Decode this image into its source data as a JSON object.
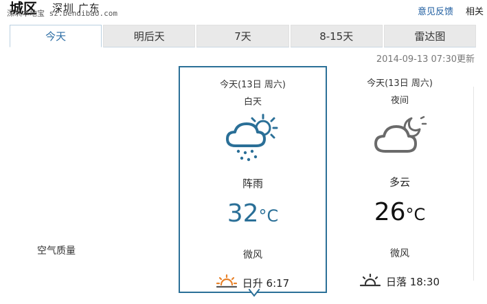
{
  "header": {
    "city": "城区",
    "region": "深圳 广东",
    "watermark": "深圳本地宝 sz.bendibao.com",
    "feedback": "意见反馈",
    "related": "相关"
  },
  "tabs": [
    {
      "label": "今天",
      "active": true
    },
    {
      "label": "明后天",
      "active": false
    },
    {
      "label": "7天",
      "active": false
    },
    {
      "label": "8-15天",
      "active": false
    },
    {
      "label": "雷达图",
      "active": false
    }
  ],
  "updated": "2014-09-13 07:30更新",
  "air_quality_label": "空气质量",
  "day": {
    "date": "今天(13日 周六)",
    "period": "白天",
    "icon": "thunder-shower-icon",
    "condition": "阵雨",
    "temp": "32",
    "unit": "°C",
    "wind": "微风",
    "sun_icon": "sunrise-icon",
    "sun_text": "日升 6:17"
  },
  "night": {
    "date": "今天(13日 周六)",
    "period": "夜间",
    "icon": "cloudy-night-icon",
    "condition": "多云",
    "temp": "26",
    "unit": "°C",
    "wind": "微风",
    "sun_icon": "sunset-icon",
    "sun_text": "日落 18:30"
  },
  "colors": {
    "accent": "#2a6f97",
    "link": "#1a5a9e",
    "sunrise_orange": "#e8822a"
  }
}
